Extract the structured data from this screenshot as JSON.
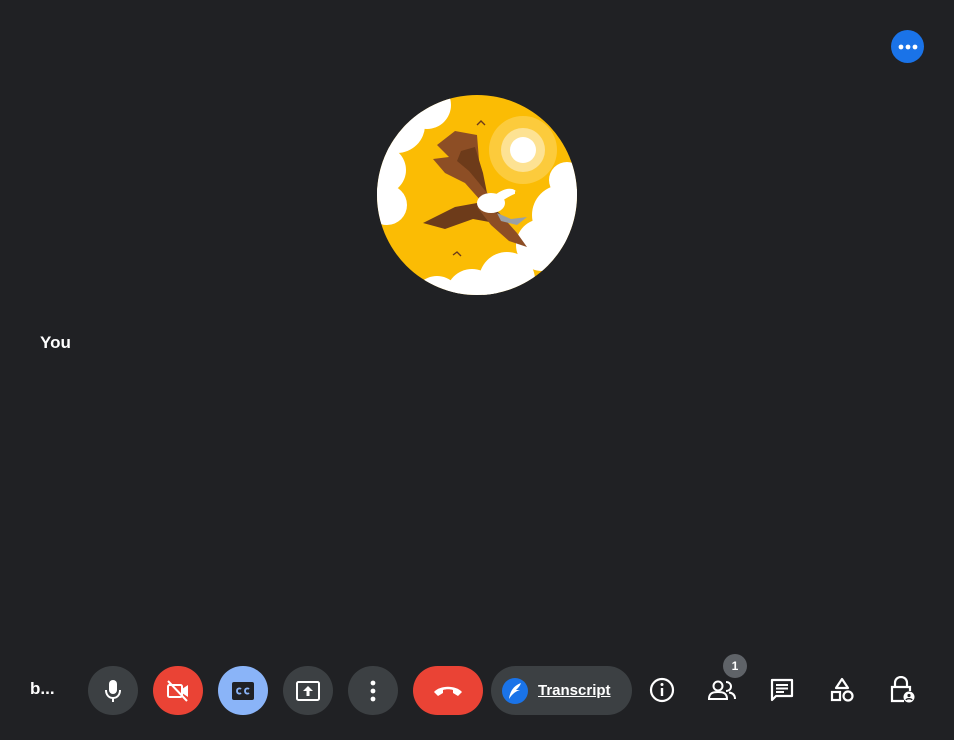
{
  "participant": {
    "self_label": "You",
    "avatar": "eagle-avatar"
  },
  "top_right": {
    "icon": "more-horiz-icon",
    "color": "#1a73e8"
  },
  "bottom_bar": {
    "meeting_name": "b...",
    "controls": [
      {
        "icon": "mic-icon",
        "state": "on"
      },
      {
        "icon": "videocam-off-icon",
        "state": "off",
        "color": "#ea4335"
      },
      {
        "icon": "closed-caption-icon",
        "state": "on",
        "color": "#8ab4f8"
      },
      {
        "icon": "present-screen-icon"
      },
      {
        "icon": "more-vert-icon"
      },
      {
        "icon": "call-end-icon",
        "color": "#ea4335"
      }
    ],
    "transcript": {
      "label": "Transcript",
      "icon": "feather-icon"
    },
    "side_panel": [
      {
        "icon": "info-icon"
      },
      {
        "icon": "people-icon",
        "badge": "1"
      },
      {
        "icon": "chat-icon"
      },
      {
        "icon": "activities-icon"
      },
      {
        "icon": "host-controls-icon"
      }
    ]
  },
  "colors": {
    "background": "#202124",
    "button": "#3c4043",
    "danger": "#ea4335",
    "accent": "#8ab4f8",
    "brand": "#1a73e8"
  }
}
